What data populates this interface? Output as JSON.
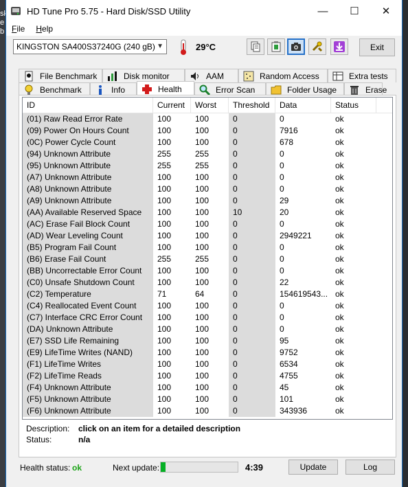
{
  "window": {
    "title": "HD Tune Pro 5.75 - Hard Disk/SSD Utility"
  },
  "background_text": [
    "sk",
    "e",
    "b"
  ],
  "menu": [
    {
      "label": "File",
      "key": "F",
      "rest": "ile"
    },
    {
      "label": "Help",
      "key": "H",
      "rest": "elp"
    }
  ],
  "toolbar": {
    "drive": "KINGSTON SA400S37240G (240 gB)",
    "temperature": "29°C",
    "exit_label": "Exit"
  },
  "tabs_top": [
    "File Benchmark",
    "Disk monitor",
    "AAM",
    "Random Access",
    "Extra tests"
  ],
  "tabs_bottom": [
    "Benchmark",
    "Info",
    "Health",
    "Error Scan",
    "Folder Usage",
    "Erase"
  ],
  "table": {
    "columns": [
      "ID",
      "Current",
      "Worst",
      "Threshold",
      "Data",
      "Status"
    ],
    "rows": [
      [
        "(01) Raw Read Error Rate",
        "100",
        "100",
        "0",
        "0",
        "ok"
      ],
      [
        "(09) Power On Hours Count",
        "100",
        "100",
        "0",
        "7916",
        "ok"
      ],
      [
        "(0C) Power Cycle Count",
        "100",
        "100",
        "0",
        "678",
        "ok"
      ],
      [
        "(94) Unknown Attribute",
        "255",
        "255",
        "0",
        "0",
        "ok"
      ],
      [
        "(95) Unknown Attribute",
        "255",
        "255",
        "0",
        "0",
        "ok"
      ],
      [
        "(A7) Unknown Attribute",
        "100",
        "100",
        "0",
        "0",
        "ok"
      ],
      [
        "(A8) Unknown Attribute",
        "100",
        "100",
        "0",
        "0",
        "ok"
      ],
      [
        "(A9) Unknown Attribute",
        "100",
        "100",
        "0",
        "29",
        "ok"
      ],
      [
        "(AA) Available Reserved Space",
        "100",
        "100",
        "10",
        "20",
        "ok"
      ],
      [
        "(AC) Erase Fail Block Count",
        "100",
        "100",
        "0",
        "0",
        "ok"
      ],
      [
        "(AD) Wear Leveling Count",
        "100",
        "100",
        "0",
        "2949221",
        "ok"
      ],
      [
        "(B5) Program Fail Count",
        "100",
        "100",
        "0",
        "0",
        "ok"
      ],
      [
        "(B6) Erase Fail Count",
        "255",
        "255",
        "0",
        "0",
        "ok"
      ],
      [
        "(BB) Uncorrectable Error Count",
        "100",
        "100",
        "0",
        "0",
        "ok"
      ],
      [
        "(C0) Unsafe Shutdown Count",
        "100",
        "100",
        "0",
        "22",
        "ok"
      ],
      [
        "(C2) Temperature",
        "71",
        "64",
        "0",
        "154619543...",
        "ok"
      ],
      [
        "(C4) Reallocated Event Count",
        "100",
        "100",
        "0",
        "0",
        "ok"
      ],
      [
        "(C7) Interface CRC Error Count",
        "100",
        "100",
        "0",
        "0",
        "ok"
      ],
      [
        "(DA) Unknown Attribute",
        "100",
        "100",
        "0",
        "0",
        "ok"
      ],
      [
        "(E7) SSD Life Remaining",
        "100",
        "100",
        "0",
        "95",
        "ok"
      ],
      [
        "(E9) LifeTime Writes (NAND)",
        "100",
        "100",
        "0",
        "9752",
        "ok"
      ],
      [
        "(F1) LifeTime Writes",
        "100",
        "100",
        "0",
        "6534",
        "ok"
      ],
      [
        "(F2) LifeTime Reads",
        "100",
        "100",
        "0",
        "4755",
        "ok"
      ],
      [
        "(F4) Unknown Attribute",
        "100",
        "100",
        "0",
        "45",
        "ok"
      ],
      [
        "(F5) Unknown Attribute",
        "100",
        "100",
        "0",
        "101",
        "ok"
      ],
      [
        "(F6) Unknown Attribute",
        "100",
        "100",
        "0",
        "343936",
        "ok"
      ]
    ]
  },
  "description": {
    "label": "Description:",
    "value": "click on an item for a detailed description"
  },
  "status": {
    "label": "Status:",
    "value": "n/a"
  },
  "footer": {
    "health_label": "Health status:",
    "health_value": "ok",
    "next_update_label": "Next update:",
    "progress_fraction": 0.06,
    "countdown": "4:39",
    "update_label": "Update",
    "log_label": "Log"
  },
  "colors": {
    "health_ok": "#1aa316",
    "progress": "#06b025",
    "accent": "#2470c8"
  }
}
